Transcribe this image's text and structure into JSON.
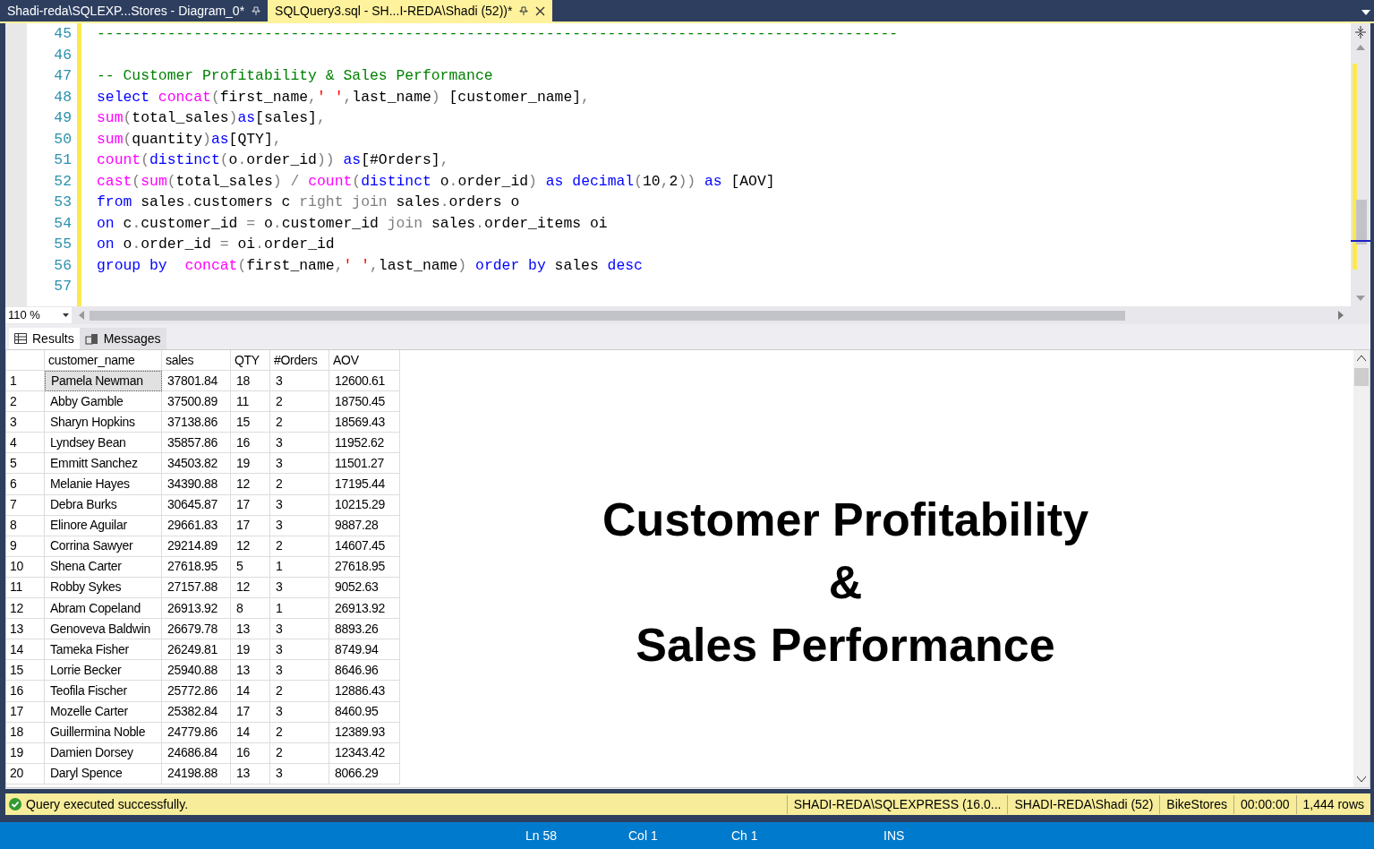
{
  "tabs": [
    {
      "label": "Shadi-reda\\SQLEXP...Stores - Diagram_0*",
      "selected": false
    },
    {
      "label": "SQLQuery3.sql - SH...I-REDA\\Shadi (52))*",
      "selected": true
    }
  ],
  "editor": {
    "zoom": "110 %",
    "lines": [
      {
        "number": "45",
        "tokens": [
          {
            "kind": "comment",
            "text": "-------------------------------------------------------------------------------------------"
          }
        ]
      },
      {
        "number": "46"
      },
      {
        "number": "47",
        "tokens": [
          {
            "kind": "comment",
            "text": "-- Customer Profitability & Sales Performance"
          }
        ]
      },
      {
        "number": "48",
        "tokens": [
          {
            "kind": "keyword",
            "text": "select "
          },
          {
            "kind": "function",
            "text": "concat"
          },
          {
            "kind": "punct",
            "text": "("
          },
          {
            "kind": "plain",
            "text": "first_name"
          },
          {
            "kind": "punct",
            "text": ","
          },
          {
            "kind": "string",
            "text": "' '"
          },
          {
            "kind": "punct",
            "text": ","
          },
          {
            "kind": "plain",
            "text": "last_name"
          },
          {
            "kind": "punct",
            "text": ")"
          },
          {
            "kind": "plain",
            "text": " [customer_name]"
          },
          {
            "kind": "punct",
            "text": ","
          }
        ]
      },
      {
        "number": "49",
        "tokens": [
          {
            "kind": "function",
            "text": "sum"
          },
          {
            "kind": "punct",
            "text": "("
          },
          {
            "kind": "plain",
            "text": "total_sales"
          },
          {
            "kind": "punct",
            "text": ")"
          },
          {
            "kind": "keyword",
            "text": "as"
          },
          {
            "kind": "plain",
            "text": "[sales]"
          },
          {
            "kind": "punct",
            "text": ","
          }
        ]
      },
      {
        "number": "50",
        "tokens": [
          {
            "kind": "function",
            "text": "sum"
          },
          {
            "kind": "punct",
            "text": "("
          },
          {
            "kind": "plain",
            "text": "quantity"
          },
          {
            "kind": "punct",
            "text": ")"
          },
          {
            "kind": "keyword",
            "text": "as"
          },
          {
            "kind": "plain",
            "text": "[QTY]"
          },
          {
            "kind": "punct",
            "text": ","
          }
        ]
      },
      {
        "number": "51",
        "tokens": [
          {
            "kind": "function",
            "text": "count"
          },
          {
            "kind": "punct",
            "text": "("
          },
          {
            "kind": "keyword",
            "text": "distinct"
          },
          {
            "kind": "punct",
            "text": "("
          },
          {
            "kind": "plain",
            "text": "o"
          },
          {
            "kind": "punct",
            "text": "."
          },
          {
            "kind": "plain",
            "text": "order_id"
          },
          {
            "kind": "punct",
            "text": ")) "
          },
          {
            "kind": "keyword",
            "text": "as"
          },
          {
            "kind": "plain",
            "text": "[#Orders]"
          },
          {
            "kind": "punct",
            "text": ","
          }
        ]
      },
      {
        "number": "52",
        "tokens": [
          {
            "kind": "function",
            "text": "cast"
          },
          {
            "kind": "punct",
            "text": "("
          },
          {
            "kind": "function",
            "text": "sum"
          },
          {
            "kind": "punct",
            "text": "("
          },
          {
            "kind": "plain",
            "text": "total_sales"
          },
          {
            "kind": "punct",
            "text": ") / "
          },
          {
            "kind": "function",
            "text": "count"
          },
          {
            "kind": "punct",
            "text": "("
          },
          {
            "kind": "keyword",
            "text": "distinct"
          },
          {
            "kind": "plain",
            "text": " o"
          },
          {
            "kind": "punct",
            "text": "."
          },
          {
            "kind": "plain",
            "text": "order_id"
          },
          {
            "kind": "punct",
            "text": ") "
          },
          {
            "kind": "keyword",
            "text": "as decimal"
          },
          {
            "kind": "punct",
            "text": "("
          },
          {
            "kind": "plain",
            "text": "10"
          },
          {
            "kind": "punct",
            "text": ","
          },
          {
            "kind": "plain",
            "text": "2"
          },
          {
            "kind": "punct",
            "text": ")) "
          },
          {
            "kind": "keyword",
            "text": "as"
          },
          {
            "kind": "plain",
            "text": " [AOV]"
          }
        ]
      },
      {
        "number": "53",
        "tokens": [
          {
            "kind": "keyword",
            "text": "from"
          },
          {
            "kind": "plain",
            "text": " sales"
          },
          {
            "kind": "punct",
            "text": "."
          },
          {
            "kind": "plain",
            "text": "customers c "
          },
          {
            "kind": "punct",
            "text": "right join"
          },
          {
            "kind": "plain",
            "text": " sales"
          },
          {
            "kind": "punct",
            "text": "."
          },
          {
            "kind": "plain",
            "text": "orders o"
          }
        ]
      },
      {
        "number": "54",
        "tokens": [
          {
            "kind": "keyword",
            "text": "on"
          },
          {
            "kind": "plain",
            "text": " c"
          },
          {
            "kind": "punct",
            "text": "."
          },
          {
            "kind": "plain",
            "text": "customer_id "
          },
          {
            "kind": "punct",
            "text": "="
          },
          {
            "kind": "plain",
            "text": " o"
          },
          {
            "kind": "punct",
            "text": "."
          },
          {
            "kind": "plain",
            "text": "customer_id "
          },
          {
            "kind": "punct",
            "text": "join"
          },
          {
            "kind": "plain",
            "text": " sales"
          },
          {
            "kind": "punct",
            "text": "."
          },
          {
            "kind": "plain",
            "text": "order_items oi"
          }
        ]
      },
      {
        "number": "55",
        "tokens": [
          {
            "kind": "keyword",
            "text": "on"
          },
          {
            "kind": "plain",
            "text": " o"
          },
          {
            "kind": "punct",
            "text": "."
          },
          {
            "kind": "plain",
            "text": "order_id "
          },
          {
            "kind": "punct",
            "text": "="
          },
          {
            "kind": "plain",
            "text": " oi"
          },
          {
            "kind": "punct",
            "text": "."
          },
          {
            "kind": "plain",
            "text": "order_id"
          }
        ]
      },
      {
        "number": "56",
        "tokens": [
          {
            "kind": "keyword",
            "text": "group by  "
          },
          {
            "kind": "function",
            "text": "concat"
          },
          {
            "kind": "punct",
            "text": "("
          },
          {
            "kind": "plain",
            "text": "first_name"
          },
          {
            "kind": "punct",
            "text": ","
          },
          {
            "kind": "string",
            "text": "' '"
          },
          {
            "kind": "punct",
            "text": ","
          },
          {
            "kind": "plain",
            "text": "last_name"
          },
          {
            "kind": "punct",
            "text": ") "
          },
          {
            "kind": "keyword",
            "text": "order by"
          },
          {
            "kind": "plain",
            "text": " sales "
          },
          {
            "kind": "keyword",
            "text": "desc"
          }
        ]
      },
      {
        "number": "57"
      }
    ]
  },
  "result_tabs": [
    {
      "label": "Results",
      "selected": true
    },
    {
      "label": "Messages",
      "selected": false
    }
  ],
  "grid": {
    "columns": [
      "customer_name",
      "sales",
      "QTY",
      "#Orders",
      "AOV"
    ],
    "rows": [
      {
        "number": "1",
        "selected": true,
        "cells": [
          "Pamela Newman",
          "37801.84",
          "18",
          "3",
          "12600.61"
        ]
      },
      {
        "number": "2",
        "selected": false,
        "cells": [
          "Abby Gamble",
          "37500.89",
          "11",
          "2",
          "18750.45"
        ]
      },
      {
        "number": "3",
        "selected": false,
        "cells": [
          "Sharyn Hopkins",
          "37138.86",
          "15",
          "2",
          "18569.43"
        ]
      },
      {
        "number": "4",
        "selected": false,
        "cells": [
          "Lyndsey Bean",
          "35857.86",
          "16",
          "3",
          "11952.62"
        ]
      },
      {
        "number": "5",
        "selected": false,
        "cells": [
          "Emmitt Sanchez",
          "34503.82",
          "19",
          "3",
          "11501.27"
        ]
      },
      {
        "number": "6",
        "selected": false,
        "cells": [
          "Melanie Hayes",
          "34390.88",
          "12",
          "2",
          "17195.44"
        ]
      },
      {
        "number": "7",
        "selected": false,
        "cells": [
          "Debra Burks",
          "30645.87",
          "17",
          "3",
          "10215.29"
        ]
      },
      {
        "number": "8",
        "selected": false,
        "cells": [
          "Elinore Aguilar",
          "29661.83",
          "17",
          "3",
          "9887.28"
        ]
      },
      {
        "number": "9",
        "selected": false,
        "cells": [
          "Corrina Sawyer",
          "29214.89",
          "12",
          "2",
          "14607.45"
        ]
      },
      {
        "number": "10",
        "selected": false,
        "cells": [
          "Shena Carter",
          "27618.95",
          "5",
          "1",
          "27618.95"
        ]
      },
      {
        "number": "11",
        "selected": false,
        "cells": [
          "Robby Sykes",
          "27157.88",
          "12",
          "3",
          "9052.63"
        ]
      },
      {
        "number": "12",
        "selected": false,
        "cells": [
          "Abram Copeland",
          "26913.92",
          "8",
          "1",
          "26913.92"
        ]
      },
      {
        "number": "13",
        "selected": false,
        "cells": [
          "Genoveva Baldwin",
          "26679.78",
          "13",
          "3",
          "8893.26"
        ]
      },
      {
        "number": "14",
        "selected": false,
        "cells": [
          "Tameka Fisher",
          "26249.81",
          "19",
          "3",
          "8749.94"
        ]
      },
      {
        "number": "15",
        "selected": false,
        "cells": [
          "Lorrie Becker",
          "25940.88",
          "13",
          "3",
          "8646.96"
        ]
      },
      {
        "number": "16",
        "selected": false,
        "cells": [
          "Teofila Fischer",
          "25772.86",
          "14",
          "2",
          "12886.43"
        ]
      },
      {
        "number": "17",
        "selected": false,
        "cells": [
          "Mozelle Carter",
          "25382.84",
          "17",
          "3",
          "8460.95"
        ]
      },
      {
        "number": "18",
        "selected": false,
        "cells": [
          "Guillermina Noble",
          "24779.86",
          "14",
          "2",
          "12389.93"
        ]
      },
      {
        "number": "19",
        "selected": false,
        "cells": [
          "Damien Dorsey",
          "24686.84",
          "16",
          "2",
          "12343.42"
        ]
      },
      {
        "number": "20",
        "selected": false,
        "cells": [
          "Daryl Spence",
          "24198.88",
          "13",
          "3",
          "8066.29"
        ]
      }
    ]
  },
  "overlay_title": [
    "Customer Profitability",
    "&",
    "Sales Performance"
  ],
  "status_bar": {
    "message": "Query executed successfully.",
    "sections": [
      "SHADI-REDA\\SQLEXPRESS (16.0...",
      "SHADI-REDA\\Shadi (52)",
      "BikeStores",
      "00:00:00",
      "1,444 rows"
    ]
  },
  "bottom_bar": [
    "Ln 58",
    "Col 1",
    "Ch 1",
    "INS"
  ]
}
